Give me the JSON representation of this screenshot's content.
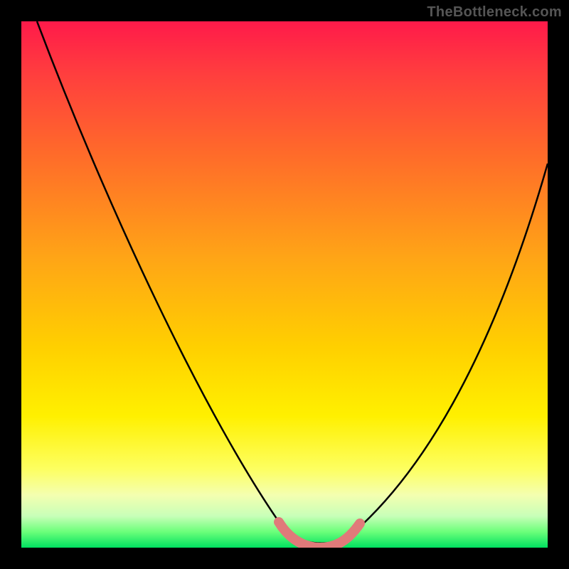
{
  "watermark": "TheBottleneck.com",
  "chart_data": {
    "type": "line",
    "title": "",
    "xlabel": "",
    "ylabel": "",
    "xlim": [
      0,
      100
    ],
    "ylim": [
      0,
      100
    ],
    "gradient_meaning": "bottleneck severity (red = high bottleneck, green = balanced)",
    "series": [
      {
        "name": "bottleneck-curve",
        "x": [
          3,
          10,
          20,
          30,
          40,
          48,
          52,
          55,
          58,
          61,
          64,
          70,
          80,
          90,
          100
        ],
        "values": [
          100,
          85,
          67,
          49,
          31,
          14,
          4,
          1,
          1,
          1,
          4,
          16,
          36,
          55,
          73
        ]
      },
      {
        "name": "optimal-zone-highlight",
        "x": [
          52,
          54,
          56,
          58,
          60,
          62,
          64
        ],
        "values": [
          4,
          2,
          1,
          1,
          1,
          2,
          4
        ]
      }
    ],
    "annotations": [],
    "legend": []
  }
}
